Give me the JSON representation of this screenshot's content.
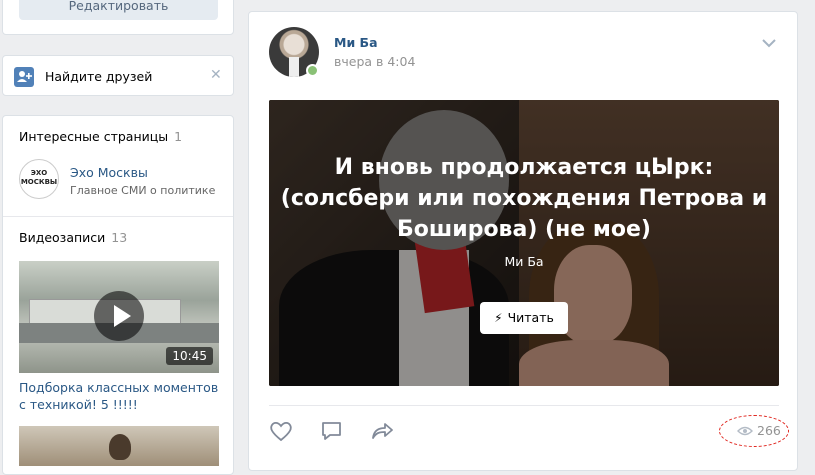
{
  "left_column": {
    "edit_button_label": "Редактировать",
    "find_friends": {
      "label": "Найдите друзей",
      "close_glyph": "✕"
    },
    "interesting_pages": {
      "title": "Интересные страницы",
      "count": "1",
      "items": [
        {
          "name": "Эхо Москвы",
          "description": "Главное СМИ о политике",
          "logo_text": "ЭХО МОСКВЫ"
        }
      ]
    },
    "videos": {
      "title": "Видеозаписи",
      "count": "13",
      "items": [
        {
          "duration": "10:45",
          "caption": "Подборка классных моментов с техникой! 5 !!!!!"
        }
      ]
    }
  },
  "post": {
    "author": "Ми Ба",
    "time": "вчера в 4:04",
    "article": {
      "title": "И вновь продолжается цЫрк: (солсбери или похождения Петрова и Боширова) (не мое)",
      "author": "Ми Ба",
      "read_button_label": "Читать"
    },
    "views_count": "266"
  },
  "colors": {
    "page_bg": "#edeef0",
    "link": "#2a5885",
    "accent": "#5181b8",
    "online": "#8ac176",
    "highlight": "#e0261f"
  },
  "icons": [
    "add-friend-icon",
    "close-icon",
    "play-icon",
    "chevron-down-icon",
    "lightning-icon",
    "heart-icon",
    "comment-icon",
    "share-icon",
    "eye-icon"
  ]
}
